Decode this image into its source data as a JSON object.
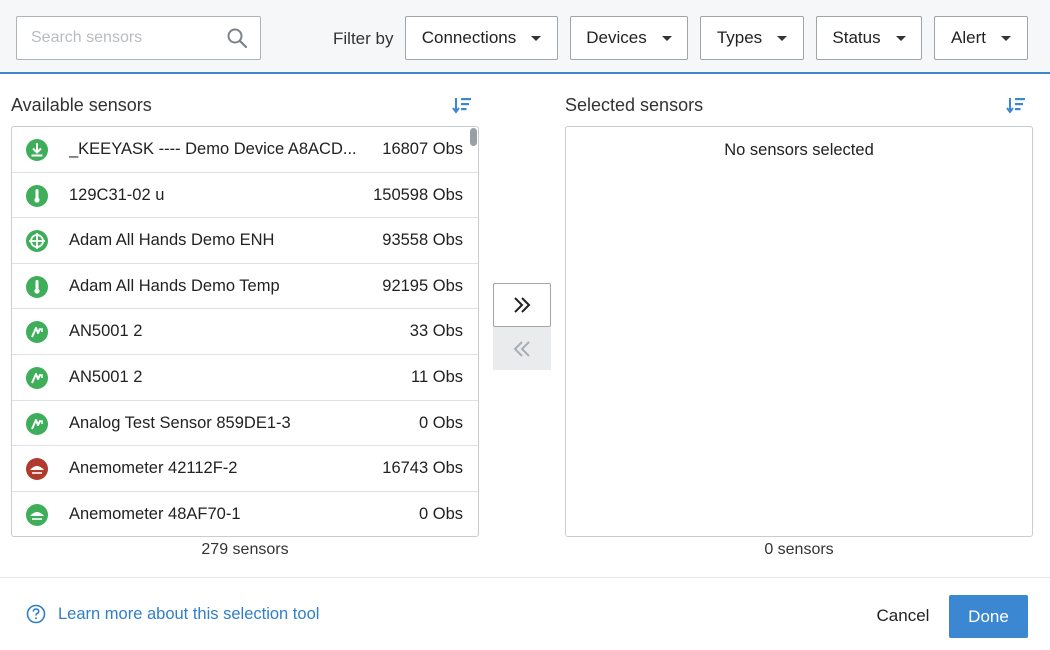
{
  "search": {
    "placeholder": "Search sensors",
    "value": ""
  },
  "filter": {
    "label": "Filter by",
    "dropdowns": [
      "Connections",
      "Devices",
      "Types",
      "Status",
      "Alert"
    ]
  },
  "available": {
    "title": "Available sensors",
    "count": "279 sensors",
    "items": [
      {
        "name": "_KEEYASK ---- Demo Device A8ACD...",
        "obs": "16807 Obs",
        "icon": "download-icon"
      },
      {
        "name": "129C31-02 u",
        "obs": "150598 Obs",
        "icon": "thermometer-icon"
      },
      {
        "name": "Adam All Hands Demo ENH",
        "obs": "93558 Obs",
        "icon": "crosshair-icon"
      },
      {
        "name": "Adam All Hands Demo Temp",
        "obs": "92195 Obs",
        "icon": "thermometer-icon"
      },
      {
        "name": "AN5001 2",
        "obs": "33 Obs",
        "icon": "analog-gauge-icon"
      },
      {
        "name": "AN5001 2",
        "obs": "11 Obs",
        "icon": "analog-gauge-icon"
      },
      {
        "name": "Analog Test Sensor 859DE1-3",
        "obs": "0 Obs",
        "icon": "analog-gauge-icon"
      },
      {
        "name": "Anemometer 42112F-2",
        "obs": "16743 Obs",
        "icon": "wind-icon"
      },
      {
        "name": "Anemometer 48AF70-1",
        "obs": "0 Obs",
        "icon": "wind-icon"
      }
    ]
  },
  "selected": {
    "title": "Selected sensors",
    "empty_message": "No sensors selected",
    "count": "0 sensors"
  },
  "footer": {
    "help_text": "Learn more about this selection tool",
    "cancel_label": "Cancel",
    "done_label": "Done"
  },
  "colors": {
    "accent": "#3b87d2",
    "status_green": "#3fae5a",
    "status_red": "#b03a2e"
  }
}
